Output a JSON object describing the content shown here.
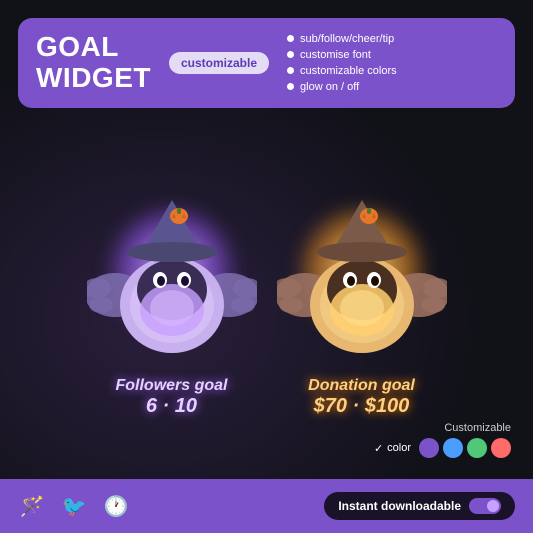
{
  "header": {
    "title_line1": "GOAL",
    "title_line2": "WIDGET",
    "badge": "customizable",
    "features": [
      "sub/follow/cheer/tip",
      "customise font",
      "customizable colors",
      "glow on / off"
    ]
  },
  "bat_purple": {
    "label": "Followers goal",
    "count": "6 · 10",
    "glow_color": "#c8a0ff"
  },
  "bat_orange": {
    "label": "Donation goal",
    "count": "$70 · $100",
    "glow_color": "#ffcf80"
  },
  "color_section": {
    "customizable": "Customizable",
    "color_label": "color",
    "swatches": [
      "#7b52c9",
      "#4a9eff",
      "#50c878",
      "#ff6b6b"
    ]
  },
  "bottom_bar": {
    "icons": [
      "🪄",
      "🐦",
      "🕐"
    ],
    "instant_label": "Instant downloadable"
  }
}
